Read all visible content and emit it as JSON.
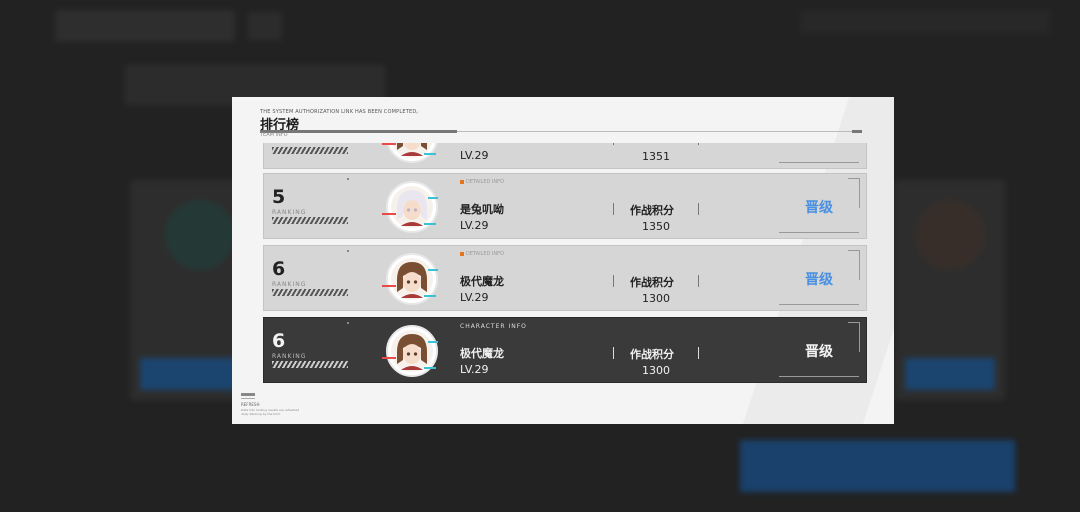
{
  "modal": {
    "subtitle": "THE SYSTEM AUTHORIZATION LINK HAS BEEN COMPLETED。",
    "title": "排行榜",
    "english": "TEAM INFO",
    "footer_title": "REFRESH",
    "footer_text": "Data Info ranking results are refreshed daily. Ranking by the form"
  },
  "rows": [
    {
      "rank": "",
      "rank_label": "",
      "name": "",
      "level": "LV.29",
      "score_label": "",
      "score": "1351",
      "action": "",
      "highlighted": false,
      "avatar_icon": "brown-hair-character-avatar-icon"
    },
    {
      "rank": "5",
      "rank_label": "RANKING",
      "tag": "DETAILED INFO",
      "name": "是兔叽呦",
      "level": "LV.29",
      "score_label": "作战积分",
      "score": "1350",
      "action": "晋级",
      "highlighted": false,
      "avatar_icon": "silver-hair-character-avatar-icon"
    },
    {
      "rank": "6",
      "rank_label": "RANKING",
      "tag": "DETAILED INFO",
      "name": "极代魔龙",
      "level": "LV.29",
      "score_label": "作战积分",
      "score": "1300",
      "action": "晋级",
      "highlighted": false,
      "avatar_icon": "brown-hair-character-avatar-icon"
    },
    {
      "rank": "6",
      "rank_label": "RANKING",
      "tag": "CHARACTER INFO",
      "name": "极代魔龙",
      "level": "LV.29",
      "score_label": "作战积分",
      "score": "1300",
      "action": "晋级",
      "highlighted": true,
      "avatar_icon": "brown-hair-character-avatar-icon"
    }
  ],
  "colors": {
    "accent_blue": "#4a90e2",
    "tag_orange": "#e8731d",
    "row_bg": "#d6d6d6",
    "row_dark_bg": "#3a3a3a"
  }
}
